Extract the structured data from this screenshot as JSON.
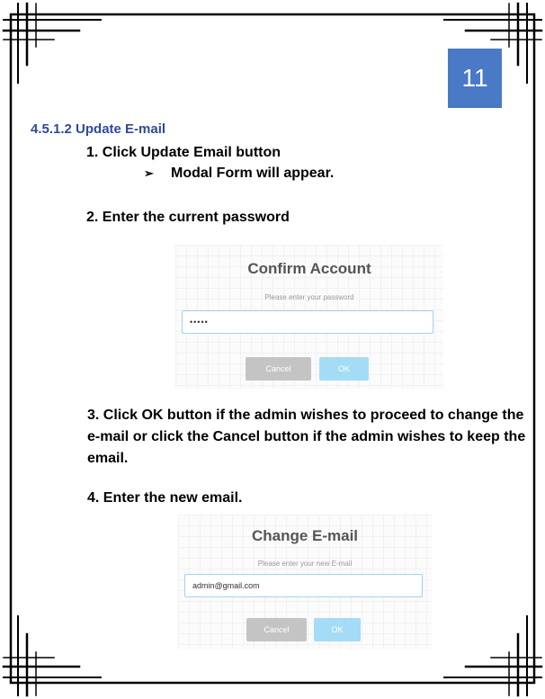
{
  "page_number": "11",
  "section_heading": "4.5.1.2 Update E-mail",
  "steps": {
    "step1": "1. Click Update Email button",
    "step1_arrow": "➢",
    "step1_sub": "Modal Form will appear.",
    "step2": "2. Enter the current password",
    "step3": "3. Click OK button if the admin wishes to proceed to change the e-mail or click the Cancel button if the admin wishes to keep the email.",
    "step4": "4. Enter the new email."
  },
  "confirm_modal": {
    "title": "Confirm Account",
    "prompt": "Please enter your password",
    "input_value": "•••••",
    "cancel_label": "Cancel",
    "ok_label": "OK"
  },
  "change_modal": {
    "title": "Change E-mail",
    "prompt": "Please enter your new E-mail",
    "input_value": "admin@gmail.com",
    "cancel_label": "Cancel",
    "ok_label": "OK"
  },
  "colors": {
    "heading": "#2f4a9a",
    "badge": "#4a79c5",
    "ok_button": "#a4dcf5",
    "cancel_button": "#c4c4c4",
    "input_border": "#9fd3ee"
  }
}
